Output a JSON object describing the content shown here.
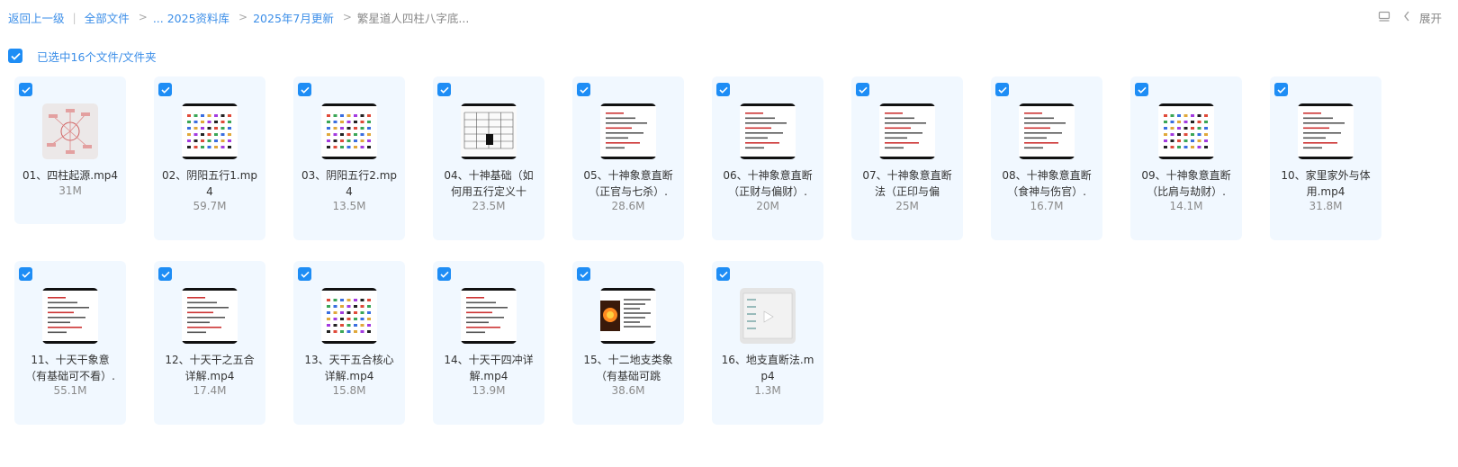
{
  "breadcrumb": {
    "back": "返回上一级",
    "items": [
      "全部文件",
      "... 2025资料库",
      "2025年7月更新"
    ],
    "current": "繁星道人四柱八字底..."
  },
  "header": {
    "expand_label": "展开"
  },
  "selection": {
    "label": "已选中16个文件/文件夹"
  },
  "accent_color": "#1e8df5",
  "files": [
    {
      "name_lines": [
        "01、四柱起源.mp4"
      ],
      "size": "31M",
      "thumb": "mindmap"
    },
    {
      "name_lines": [
        "02、阴阳五行1.mp",
        "4"
      ],
      "size": "59.7M",
      "thumb": "colorful"
    },
    {
      "name_lines": [
        "03、阴阳五行2.mp",
        "4"
      ],
      "size": "13.5M",
      "thumb": "colorful"
    },
    {
      "name_lines": [
        "04、十神基础（如",
        "何用五行定义十"
      ],
      "size": "23.5M",
      "thumb": "table"
    },
    {
      "name_lines": [
        "05、十神象意直断",
        "（正官与七杀）."
      ],
      "size": "28.6M",
      "thumb": "text"
    },
    {
      "name_lines": [
        "06、十神象意直断",
        "（正财与偏财）."
      ],
      "size": "20M",
      "thumb": "text"
    },
    {
      "name_lines": [
        "07、十神象意直断",
        "法（正印与偏"
      ],
      "size": "25M",
      "thumb": "text"
    },
    {
      "name_lines": [
        "08、十神象意直断",
        "（食神与伤官）."
      ],
      "size": "16.7M",
      "thumb": "text"
    },
    {
      "name_lines": [
        "09、十神象意直断",
        "（比肩与劫财）."
      ],
      "size": "14.1M",
      "thumb": "colorful"
    },
    {
      "name_lines": [
        "10、家里家外与体",
        "用.mp4"
      ],
      "size": "31.8M",
      "thumb": "text"
    },
    {
      "name_lines": [
        "11、十天干象意",
        "（有基础可不看）."
      ],
      "size": "55.1M",
      "thumb": "text"
    },
    {
      "name_lines": [
        "12、十天干之五合",
        "详解.mp4"
      ],
      "size": "17.4M",
      "thumb": "text"
    },
    {
      "name_lines": [
        "13、天干五合核心",
        "详解.mp4"
      ],
      "size": "15.8M",
      "thumb": "colorful"
    },
    {
      "name_lines": [
        "14、十天干四冲详",
        "解.mp4"
      ],
      "size": "13.9M",
      "thumb": "text"
    },
    {
      "name_lines": [
        "15、十二地支类象",
        "（有基础可跳"
      ],
      "size": "38.6M",
      "thumb": "fire"
    },
    {
      "name_lines": [
        "16、地支直断法.m",
        "p4"
      ],
      "size": "1.3M",
      "thumb": "gray"
    }
  ]
}
